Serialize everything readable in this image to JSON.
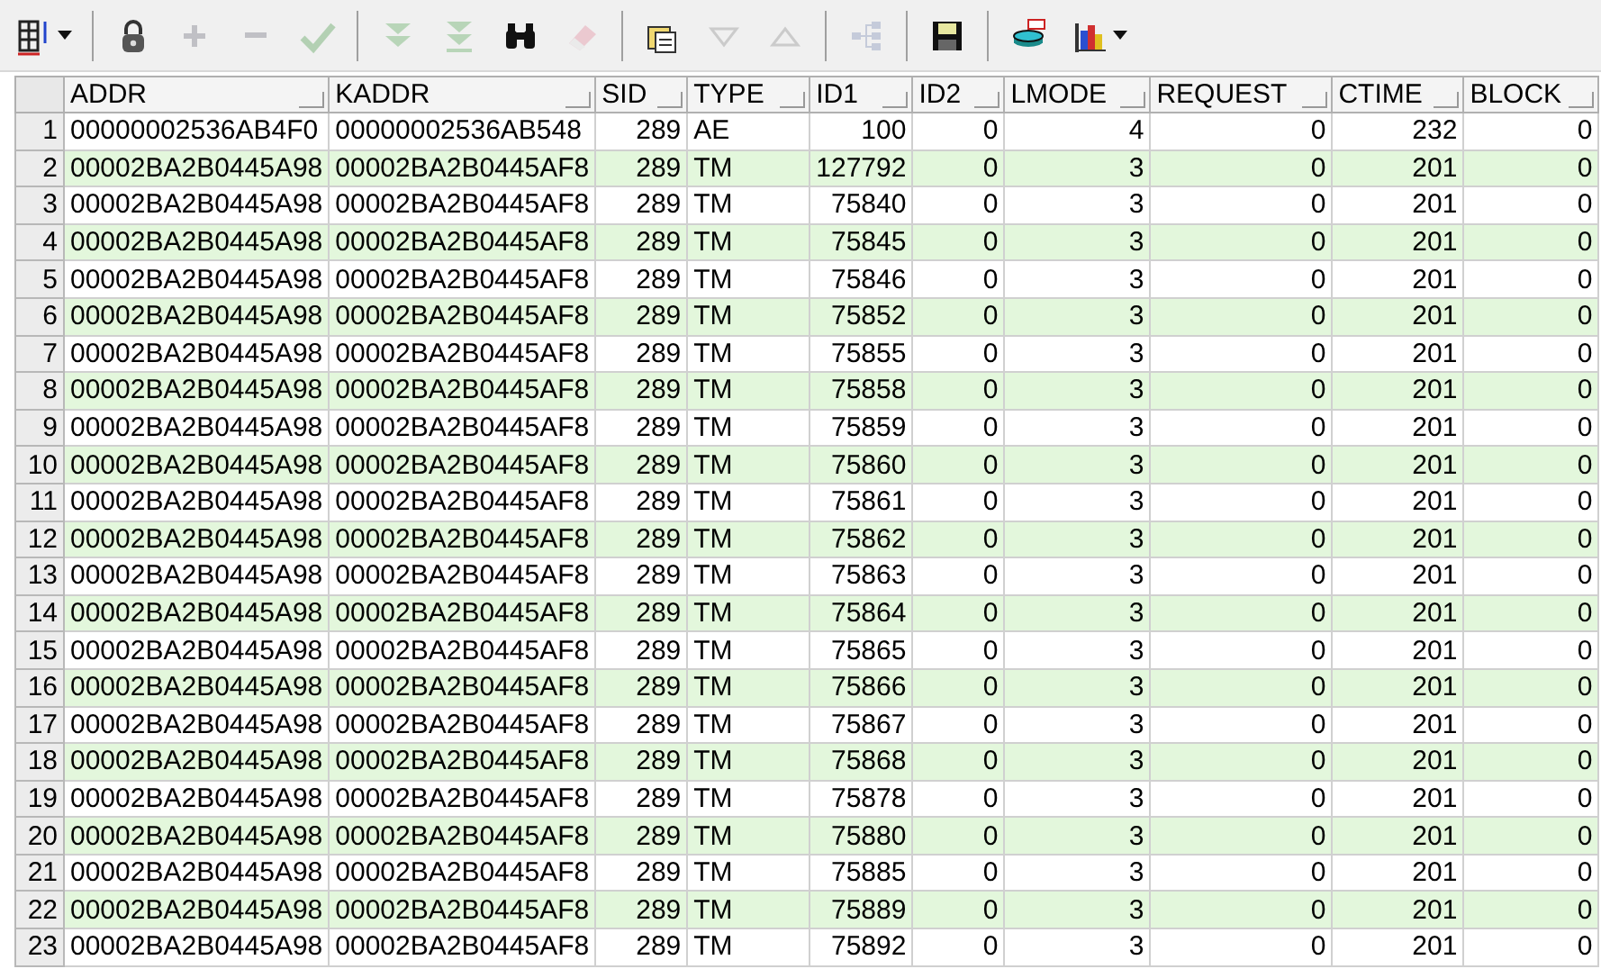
{
  "toolbar": [
    {
      "kind": "grid",
      "disabled": false,
      "dropdown": true
    },
    {
      "kind": "separator"
    },
    {
      "kind": "lock",
      "disabled": false
    },
    {
      "kind": "plus",
      "disabled": true
    },
    {
      "kind": "minus",
      "disabled": true
    },
    {
      "kind": "check",
      "disabled": true
    },
    {
      "kind": "separator"
    },
    {
      "kind": "double-down",
      "disabled": true
    },
    {
      "kind": "double-down-bar",
      "disabled": true
    },
    {
      "kind": "binoculars",
      "disabled": false
    },
    {
      "kind": "eraser",
      "disabled": true
    },
    {
      "kind": "separator"
    },
    {
      "kind": "stack",
      "disabled": false
    },
    {
      "kind": "triangle-down",
      "disabled": true
    },
    {
      "kind": "triangle-up",
      "disabled": true
    },
    {
      "kind": "separator"
    },
    {
      "kind": "tree",
      "disabled": true
    },
    {
      "kind": "separator"
    },
    {
      "kind": "save",
      "disabled": false
    },
    {
      "kind": "separator"
    },
    {
      "kind": "database",
      "disabled": false
    },
    {
      "kind": "chart",
      "disabled": false,
      "dropdown": true
    }
  ],
  "table": {
    "columns": [
      "ADDR",
      "KADDR",
      "SID",
      "TYPE",
      "ID1",
      "ID2",
      "LMODE",
      "REQUEST",
      "CTIME",
      "BLOCK"
    ],
    "rows": [
      {
        "number": "1",
        "cells": [
          "00000002536AB4F0",
          "00000002536AB548",
          "289",
          "AE",
          "100",
          "0",
          "4",
          "0",
          "232",
          "0"
        ]
      },
      {
        "number": "2",
        "cells": [
          "00002BA2B0445A98",
          "00002BA2B0445AF8",
          "289",
          "TM",
          "127792",
          "0",
          "3",
          "0",
          "201",
          "0"
        ]
      },
      {
        "number": "3",
        "cells": [
          "00002BA2B0445A98",
          "00002BA2B0445AF8",
          "289",
          "TM",
          "75840",
          "0",
          "3",
          "0",
          "201",
          "0"
        ]
      },
      {
        "number": "4",
        "cells": [
          "00002BA2B0445A98",
          "00002BA2B0445AF8",
          "289",
          "TM",
          "75845",
          "0",
          "3",
          "0",
          "201",
          "0"
        ]
      },
      {
        "number": "5",
        "cells": [
          "00002BA2B0445A98",
          "00002BA2B0445AF8",
          "289",
          "TM",
          "75846",
          "0",
          "3",
          "0",
          "201",
          "0"
        ]
      },
      {
        "number": "6",
        "cells": [
          "00002BA2B0445A98",
          "00002BA2B0445AF8",
          "289",
          "TM",
          "75852",
          "0",
          "3",
          "0",
          "201",
          "0"
        ]
      },
      {
        "number": "7",
        "cells": [
          "00002BA2B0445A98",
          "00002BA2B0445AF8",
          "289",
          "TM",
          "75855",
          "0",
          "3",
          "0",
          "201",
          "0"
        ]
      },
      {
        "number": "8",
        "cells": [
          "00002BA2B0445A98",
          "00002BA2B0445AF8",
          "289",
          "TM",
          "75858",
          "0",
          "3",
          "0",
          "201",
          "0"
        ]
      },
      {
        "number": "9",
        "cells": [
          "00002BA2B0445A98",
          "00002BA2B0445AF8",
          "289",
          "TM",
          "75859",
          "0",
          "3",
          "0",
          "201",
          "0"
        ]
      },
      {
        "number": "10",
        "cells": [
          "00002BA2B0445A98",
          "00002BA2B0445AF8",
          "289",
          "TM",
          "75860",
          "0",
          "3",
          "0",
          "201",
          "0"
        ]
      },
      {
        "number": "11",
        "cells": [
          "00002BA2B0445A98",
          "00002BA2B0445AF8",
          "289",
          "TM",
          "75861",
          "0",
          "3",
          "0",
          "201",
          "0"
        ]
      },
      {
        "number": "12",
        "cells": [
          "00002BA2B0445A98",
          "00002BA2B0445AF8",
          "289",
          "TM",
          "75862",
          "0",
          "3",
          "0",
          "201",
          "0"
        ]
      },
      {
        "number": "13",
        "cells": [
          "00002BA2B0445A98",
          "00002BA2B0445AF8",
          "289",
          "TM",
          "75863",
          "0",
          "3",
          "0",
          "201",
          "0"
        ]
      },
      {
        "number": "14",
        "cells": [
          "00002BA2B0445A98",
          "00002BA2B0445AF8",
          "289",
          "TM",
          "75864",
          "0",
          "3",
          "0",
          "201",
          "0"
        ]
      },
      {
        "number": "15",
        "cells": [
          "00002BA2B0445A98",
          "00002BA2B0445AF8",
          "289",
          "TM",
          "75865",
          "0",
          "3",
          "0",
          "201",
          "0"
        ]
      },
      {
        "number": "16",
        "cells": [
          "00002BA2B0445A98",
          "00002BA2B0445AF8",
          "289",
          "TM",
          "75866",
          "0",
          "3",
          "0",
          "201",
          "0"
        ]
      },
      {
        "number": "17",
        "cells": [
          "00002BA2B0445A98",
          "00002BA2B0445AF8",
          "289",
          "TM",
          "75867",
          "0",
          "3",
          "0",
          "201",
          "0"
        ]
      },
      {
        "number": "18",
        "cells": [
          "00002BA2B0445A98",
          "00002BA2B0445AF8",
          "289",
          "TM",
          "75868",
          "0",
          "3",
          "0",
          "201",
          "0"
        ]
      },
      {
        "number": "19",
        "cells": [
          "00002BA2B0445A98",
          "00002BA2B0445AF8",
          "289",
          "TM",
          "75878",
          "0",
          "3",
          "0",
          "201",
          "0"
        ]
      },
      {
        "number": "20",
        "cells": [
          "00002BA2B0445A98",
          "00002BA2B0445AF8",
          "289",
          "TM",
          "75880",
          "0",
          "3",
          "0",
          "201",
          "0"
        ]
      },
      {
        "number": "21",
        "cells": [
          "00002BA2B0445A98",
          "00002BA2B0445AF8",
          "289",
          "TM",
          "75885",
          "0",
          "3",
          "0",
          "201",
          "0"
        ]
      },
      {
        "number": "22",
        "cells": [
          "00002BA2B0445A98",
          "00002BA2B0445AF8",
          "289",
          "TM",
          "75889",
          "0",
          "3",
          "0",
          "201",
          "0"
        ]
      },
      {
        "number": "23",
        "cells": [
          "00002BA2B0445A98",
          "00002BA2B0445AF8",
          "289",
          "TM",
          "75892",
          "0",
          "3",
          "0",
          "201",
          "0"
        ]
      }
    ]
  }
}
